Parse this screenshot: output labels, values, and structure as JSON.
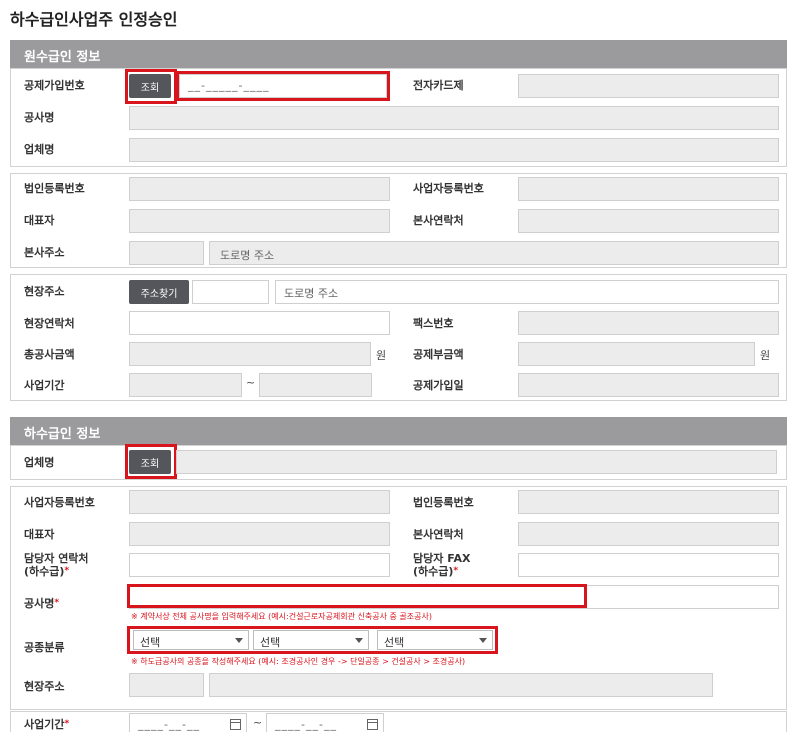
{
  "page_title": "하수급인사업주 인정승인",
  "contractor_section": {
    "heading": "원수급인 정보",
    "membership_no_label": "공제가입번호",
    "lookup_button": "조회",
    "membership_no_placeholder": "__-_____-____",
    "ecard_label": "전자카드제",
    "project_name_label": "공사명",
    "company_name_label": "업체명",
    "corp_reg_no_label": "법인등록번호",
    "biz_reg_no_label": "사업자등록번호",
    "ceo_label": "대표자",
    "hq_contact_label": "본사연락처",
    "hq_address_label": "본사주소",
    "road_address_placeholder": "도로명 주소",
    "site_address_label": "현장주소",
    "address_search_button": "주소찾기",
    "site_road_address_placeholder": "도로명 주소",
    "site_contact_label": "현장연락처",
    "fax_label": "팩스번호",
    "total_cost_label": "총공사금액",
    "won_unit": "원",
    "deduction_amount_label": "공제부금액",
    "won_unit_2": "원",
    "project_period_label": "사업기간",
    "tilde": "~",
    "membership_date_label": "공제가입일"
  },
  "subcontractor_section": {
    "heading": "하수급인 정보",
    "company_name_label": "업체명",
    "lookup_button": "조회",
    "biz_reg_no_label": "사업자등록번호",
    "corp_reg_no_label": "법인등록번호",
    "ceo_label": "대표자",
    "hq_contact_label": "본사연락처",
    "manager_contact_label_1": "담당자 연락처",
    "manager_contact_label_2": "(하수급)",
    "manager_fax_label_1": "담당자 FAX",
    "manager_fax_label_2": "(하수급)",
    "required_mark": "*",
    "project_name_label": "공사명",
    "project_name_note": "※ 계약서상 전체 공사명을 입력해주세요 (예시:건설근로자공제회관 신축공사 중 골조공사)",
    "work_category_label": "공종분류",
    "select_options": [
      "선택",
      "선택",
      "선택"
    ],
    "work_category_note": "※ 하도급공사의 공종을 작성해주세요 (예시: 조경공사인 경우 -> 단일공종 > 건설공사 > 조경공사)",
    "site_address_label": "현장주소",
    "project_period_label": "사업기간",
    "date_placeholder": "____-__-__",
    "tilde": "~"
  },
  "colors": {
    "section_header": "#9b9b9e",
    "button": "#55565c",
    "highlight": "#d8141d",
    "readonly_field": "#ececec"
  }
}
